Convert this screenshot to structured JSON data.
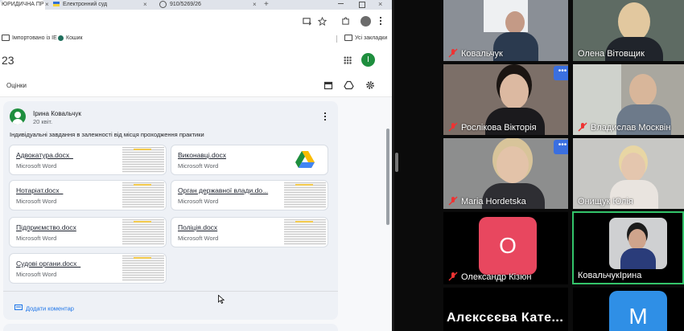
{
  "browser": {
    "tabs": [
      {
        "label": "ЮРИДИЧНА ПР"
      },
      {
        "label": "Електронний суд"
      },
      {
        "label": "910/5269/26"
      }
    ],
    "tab_close": "×",
    "new_tab": "+",
    "bookmarks": [
      {
        "label": "Імпортовано із IE"
      },
      {
        "label": "Кошик"
      },
      {
        "label": "Усі закладки"
      }
    ]
  },
  "classroom": {
    "header_title": "23",
    "avatar_letter": "I",
    "subtab": "Оцінки",
    "post": {
      "author": "Ірина Ковальчук",
      "date": "20 квіт.",
      "text": "Індивідуальні завдання в залежності від місця проходження практики",
      "attachments": [
        {
          "title": "Адвокатура.docx_",
          "type": "Microsoft Word"
        },
        {
          "title": "Виконавці.docx",
          "type": "Microsoft Word"
        },
        {
          "title": "Нотаріат.docx_",
          "type": "Microsoft Word"
        },
        {
          "title": "Орган державної влади.do...",
          "type": "Microsoft Word"
        },
        {
          "title": "Підприємство.docx",
          "type": "Microsoft Word"
        },
        {
          "title": "Поліція.docx",
          "type": "Microsoft Word"
        },
        {
          "title": "Судові органи.docx_",
          "type": "Microsoft Word"
        }
      ],
      "add_comment": "Додати коментар"
    }
  },
  "meeting": {
    "participants": [
      {
        "name": "Ковальчук"
      },
      {
        "name": "Олена Вітовщик"
      },
      {
        "name": "Рослікова Вікторія"
      },
      {
        "name": "Владислав Москвін"
      },
      {
        "name": "Maria Hordetska"
      },
      {
        "name": "Онищук Юлія"
      },
      {
        "name": "Олександр Кізюн",
        "avatar_letter": "O",
        "avatar_color": "#e8475f"
      },
      {
        "name": "КовальчукІрина"
      },
      {
        "name": "Алєксєєва Кате...",
        "avatar_letter": "M",
        "avatar_color": "#2f8fe6"
      }
    ],
    "more_label": "•••",
    "active_speaker_color": "#33c46a"
  }
}
